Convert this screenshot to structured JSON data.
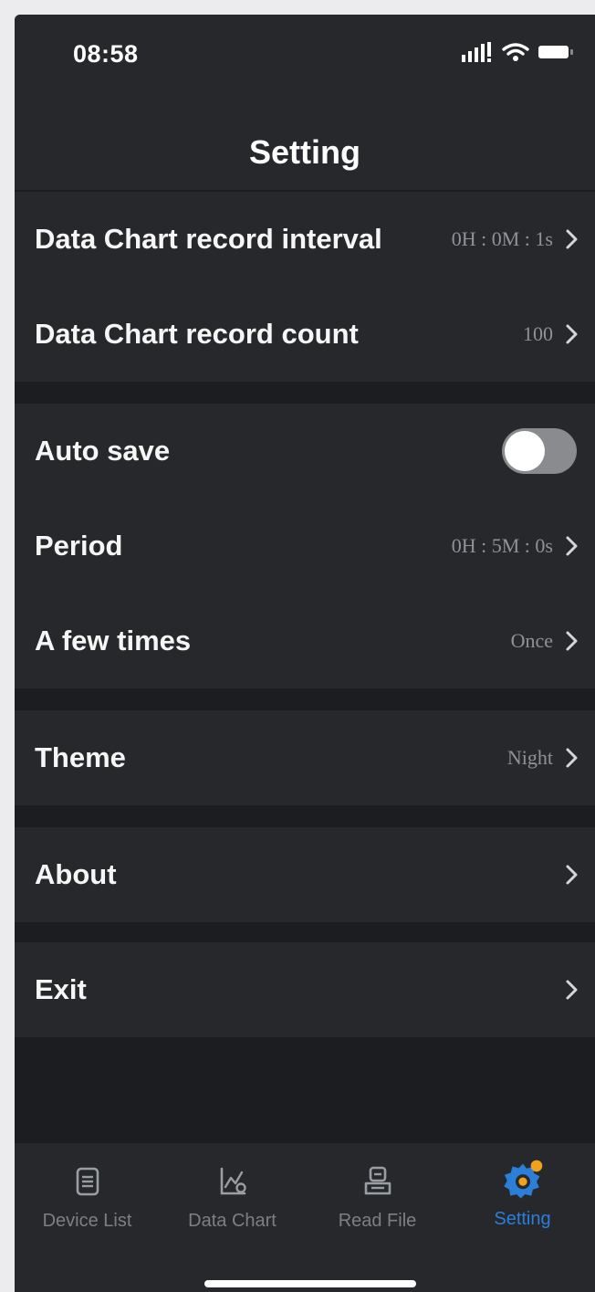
{
  "status_bar": {
    "time": "08:58"
  },
  "nav": {
    "title": "Setting"
  },
  "groups": [
    {
      "rows": [
        {
          "label": "Data Chart record interval",
          "value": "0H : 0M : 1s"
        },
        {
          "label": "Data Chart record count",
          "value": "100"
        }
      ]
    },
    {
      "rows": [
        {
          "label": "Auto save",
          "toggle_on": false
        },
        {
          "label": "Period",
          "value": "0H : 5M : 0s"
        },
        {
          "label": "A few times",
          "value": "Once"
        }
      ]
    },
    {
      "rows": [
        {
          "label": "Theme",
          "value": "Night"
        }
      ]
    },
    {
      "rows": [
        {
          "label": "About",
          "value": ""
        }
      ]
    },
    {
      "rows": [
        {
          "label": "Exit",
          "value": ""
        }
      ]
    }
  ],
  "tab_bar": {
    "tabs": [
      {
        "label": "Device List",
        "icon": "device-list-icon",
        "active": false
      },
      {
        "label": "Data Chart",
        "icon": "data-chart-icon",
        "active": false
      },
      {
        "label": "Read File",
        "icon": "read-file-icon",
        "active": false
      },
      {
        "label": "Setting",
        "icon": "gear-icon",
        "active": true
      }
    ]
  },
  "colors": {
    "background": "#1c1d20",
    "surface": "#26282c",
    "accent": "#2b7fd9",
    "badge": "#f0a21c",
    "muted_text": "#8f9298"
  }
}
